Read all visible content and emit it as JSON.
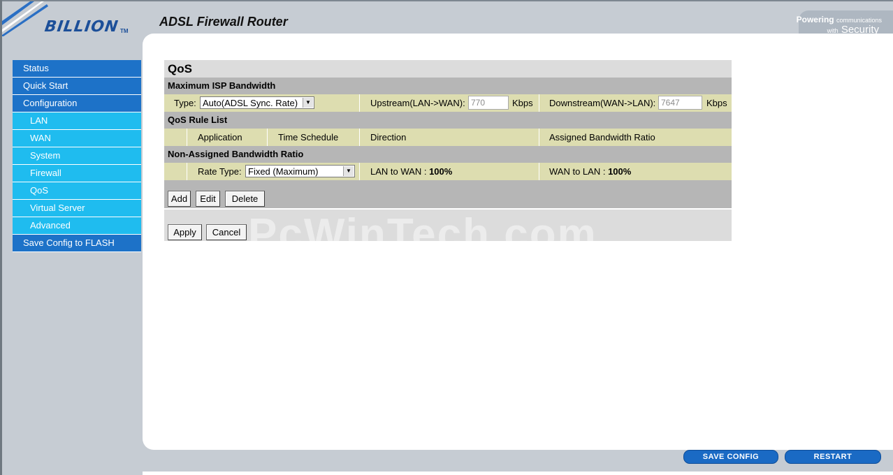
{
  "header": {
    "logo_text": "BILLION",
    "logo_tm": "TM",
    "app_title": "ADSL Firewall Router",
    "tagline_line1_strong": "Powering",
    "tagline_line1_small": "communications",
    "tagline_line2_small": "with",
    "tagline_line2": "Security"
  },
  "sidebar": {
    "items": [
      {
        "label": "Status"
      },
      {
        "label": "Quick Start"
      },
      {
        "label": "Configuration"
      },
      {
        "label": "LAN"
      },
      {
        "label": "WAN"
      },
      {
        "label": "System"
      },
      {
        "label": "Firewall"
      },
      {
        "label": "QoS"
      },
      {
        "label": "Virtual Server"
      },
      {
        "label": "Advanced"
      },
      {
        "label": "Save Config to FLASH"
      }
    ]
  },
  "qos": {
    "title": "QoS",
    "isp": {
      "heading": "Maximum ISP Bandwidth",
      "type_label": "Type:",
      "type_value": "Auto(ADSL Sync. Rate)",
      "upstream_label": "Upstream(LAN->WAN):",
      "upstream_value": "770",
      "upstream_unit": "Kbps",
      "downstream_label": "Downstream(WAN->LAN):",
      "downstream_value": "7647",
      "downstream_unit": "Kbps"
    },
    "rule_list": {
      "heading": "QoS Rule List",
      "columns": [
        "Application",
        "Time Schedule",
        "Direction",
        "Assigned Bandwidth Ratio"
      ]
    },
    "non_assigned": {
      "heading": "Non-Assigned Bandwidth Ratio",
      "rate_type_label": "Rate Type:",
      "rate_type_value": "Fixed (Maximum)",
      "lan_to_wan_label": "LAN to WAN :",
      "lan_to_wan_value": "100%",
      "wan_to_lan_label": "WAN to LAN :",
      "wan_to_lan_value": "100%"
    },
    "buttons": {
      "add": "Add",
      "edit": "Edit",
      "delete": "Delete",
      "apply": "Apply",
      "cancel": "Cancel"
    }
  },
  "watermark": "PcWinTech.com",
  "footer": {
    "save_config": "SAVE CONFIG",
    "restart": "RESTART"
  }
}
